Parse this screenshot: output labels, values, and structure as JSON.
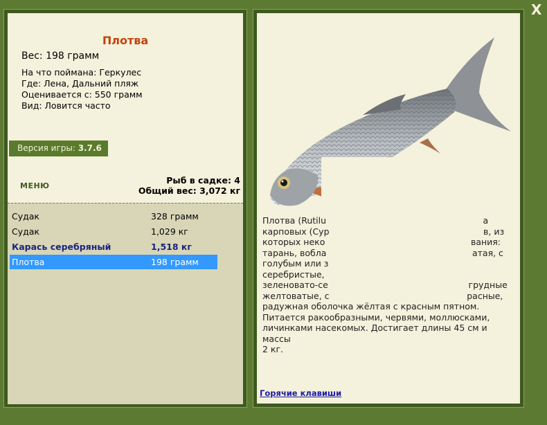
{
  "close_label": "X",
  "catch": {
    "name": "Плотва",
    "weight_line": "Вес: 198 грамм",
    "bait_line": "На что поймана: Геркулес",
    "place_line": "Где: Лена, Дальний пляж",
    "rated_line": "Оценивается с: 550 грамм",
    "kind_line": "Вид: Ловится часто"
  },
  "version": {
    "label": "Версия игры:",
    "value": "3.7.6"
  },
  "menu_label": "МЕНЮ",
  "summary": {
    "fish_count_line": "Рыб в садке: 4",
    "total_weight_line": "Общий вес: 3,072 кг"
  },
  "list": [
    {
      "name": "Судак",
      "weight": "328 грамм",
      "style": "normal"
    },
    {
      "name": "Судак",
      "weight": "1,029 кг",
      "style": "normal"
    },
    {
      "name": "Карась серебряный",
      "weight": "1,518 кг",
      "style": "bold"
    },
    {
      "name": "Плотва",
      "weight": "198 грамм",
      "style": "selected"
    }
  ],
  "description": {
    "lines": [
      "Плотва (Rutilu                                                         а",
      "карповых (Cyp                                                        в, из",
      "которых неко                                                     вания:",
      "тарань, вобла                                                     атая, с",
      "голубым или з",
      "серебристые,",
      "зеленовато-се                                                   грудные",
      "желтоватые, с                                                  расные,",
      "радужная оболочка жёлтая с красным пятном.",
      "Питается ракообразными, червями, моллюсками,",
      "личинками насекомых. Достигает длины 45 см и массы",
      "2 кг."
    ]
  },
  "hotkeys_label": "Горячие клавиши",
  "colors": {
    "background": "#5d7a32",
    "panel": "#f4f1dc",
    "title": "#c0440e",
    "selected": "#3399ff"
  }
}
